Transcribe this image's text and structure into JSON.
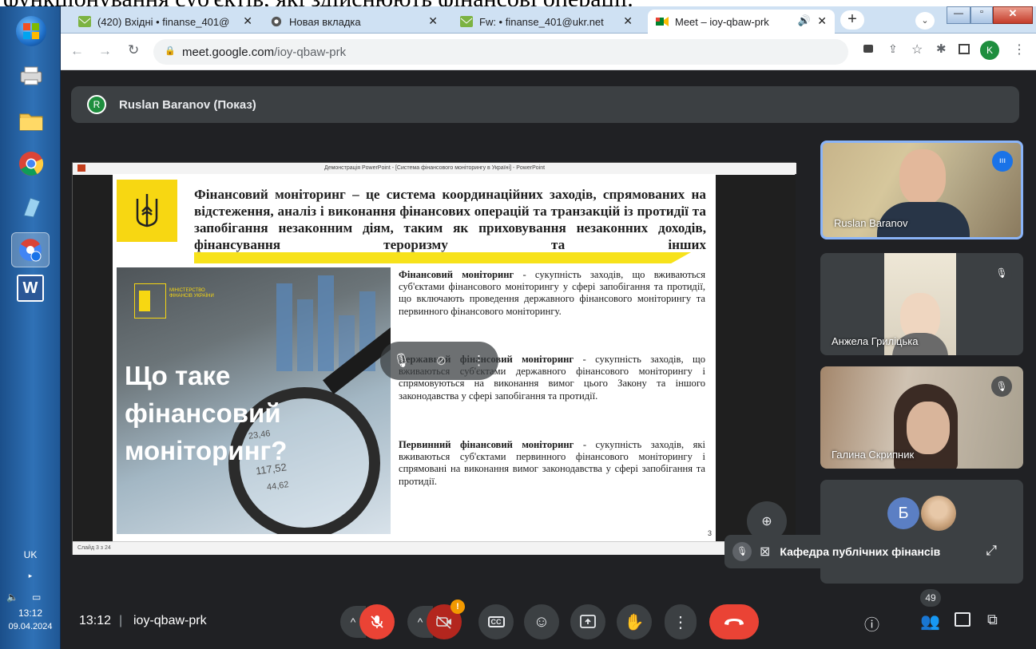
{
  "doc_fragment": "функціонування суб'єктів, які здійснюють фінансові операції.",
  "taskbar": {
    "language": "UK",
    "time": "13:12",
    "date": "09.04.2024"
  },
  "browser": {
    "tabs": [
      {
        "title": "(420) Вхідні • finanse_401@",
        "active": false
      },
      {
        "title": "Новая вкладка",
        "active": false
      },
      {
        "title": "Fw: • finanse_401@ukr.net",
        "active": false
      },
      {
        "title": "Meet – ioy-qbaw-prk",
        "active": true
      }
    ],
    "url_host": "meet.google.com",
    "url_path": "/ioy-qbaw-prk",
    "profile_initial": "K"
  },
  "meet": {
    "presenter_initial": "R",
    "presenter_label": "Ruslan Baranov (Показ)",
    "participants": [
      {
        "name": "Ruslan Baranov",
        "speaking": true
      },
      {
        "name": "Анжела Гриліцька",
        "muted": true
      },
      {
        "name": "Галина Скрипник",
        "muted": true
      },
      {
        "name": "Кафедра публічних фінансів",
        "initial": "Б"
      }
    ],
    "time": "13:12",
    "separator": "|",
    "meeting_code": "ioy-qbaw-prk",
    "people_count": "49",
    "cc_label": "CC"
  },
  "slide": {
    "window_title": "Демонстрація PowerPoint - [Система фінансового моніторингу в Україні] - PowerPoint",
    "heading": "Фінансовий моніторинг – це система координаційних заходів, спрямованих на відстеження, аналіз і виконання фінансових операцій та транзакцій із протидії та запобігання незаконним діям, таким як приховування незаконних доходів, фінансування тероризму та інших",
    "photo_title": "Що таке фінансовий моніторинг?",
    "photo_numbers": [
      "23,46",
      "117,52",
      "44,62"
    ],
    "ministry_logo_text": "МІНІСТЕРСТВО ФІНАНСІВ УКРАЇНИ",
    "para1_term": "Фінансовий моніторинг",
    "para1_text": " - сукупність заходів, що вживаються суб'єктами фінансового моніторингу у сфері запобігання та протидії, що включають проведення державного фінансового моніторингу та первинного фінансового моніторингу.",
    "para2_term": "Державний фінансовий моніторинг",
    "para2_text": " - сукупність заходів, що вживаються суб'єктами державного фінансового моніторингу і спрямовуються на виконання вимог цього Закону та іншого законодавства у сфері запобігання та протидії.",
    "para3_term": "Первинний фінансовий моніторинг",
    "para3_text": " - сукупність заходів, які вживаються суб'єктами первинного фінансового моніторингу і спрямовані на виконання вимог законодавства у сфері запобігання та протидії.",
    "page_number": "3",
    "status_left": "Слайд 3 з 24"
  },
  "colors": {
    "meet_bg": "#202124",
    "tile_bg": "#3c4043",
    "end_call_red": "#ea4335",
    "accent_blue": "#1a73e8",
    "slide_yellow": "#f7e21b"
  }
}
